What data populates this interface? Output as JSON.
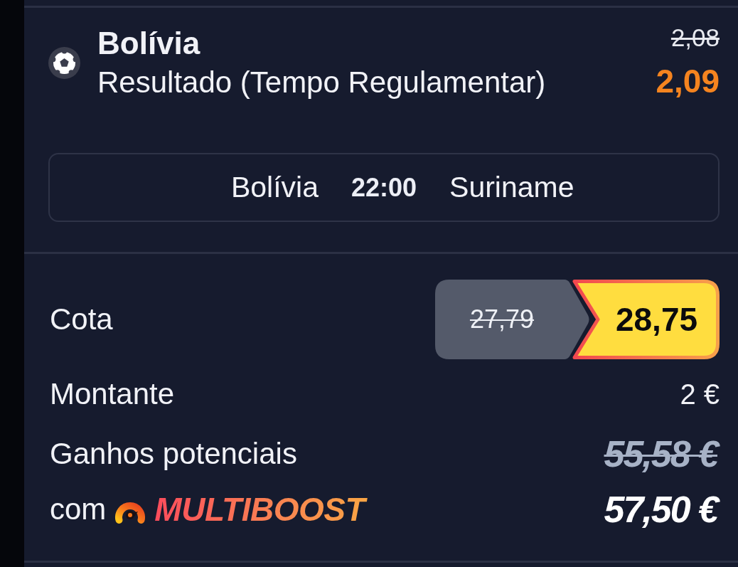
{
  "selection": {
    "team": "Bolívia",
    "market": "Resultado (Tempo Regulamentar)",
    "previous_odds": "2,08",
    "odds": "2,09"
  },
  "match": {
    "home": "Bolívia",
    "time": "22:00",
    "away": "Suriname"
  },
  "summary": {
    "odds": {
      "label": "Cota",
      "previous": "27,79",
      "current": "28,75"
    },
    "stake": {
      "label": "Montante",
      "value": "2 €"
    },
    "potential_winnings": {
      "label": "Ganhos potenciais",
      "value": "55,58 €",
      "struck": true
    },
    "boosted_winnings": {
      "prefix": "com",
      "brand": "MULTIBOOST",
      "value": "57,50 €"
    }
  }
}
